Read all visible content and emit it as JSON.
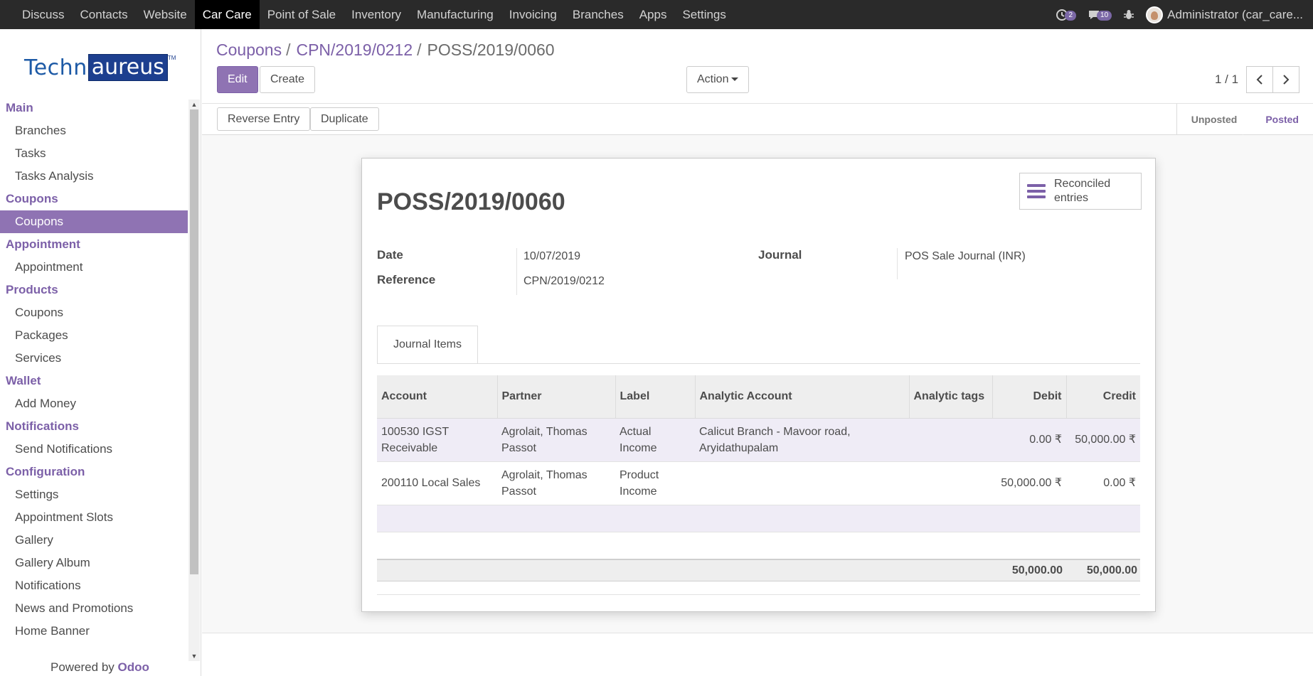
{
  "topnav": {
    "menus": [
      "Discuss",
      "Contacts",
      "Website",
      "Car Care",
      "Point of Sale",
      "Inventory",
      "Manufacturing",
      "Invoicing",
      "Branches",
      "Apps",
      "Settings"
    ],
    "active": "Car Care",
    "messages_count": "2",
    "chat_count": "10",
    "user": "Administrator (car_care..."
  },
  "sidebar": {
    "logo_left": "Techn",
    "logo_right": "aureus",
    "logo_tm": "TM",
    "sections": [
      {
        "title": "Main",
        "items": [
          "Branches",
          "Tasks",
          "Tasks Analysis"
        ]
      },
      {
        "title": "Coupons",
        "items": [
          "Coupons"
        ]
      },
      {
        "title": "Appointment",
        "items": [
          "Appointment"
        ]
      },
      {
        "title": "Products",
        "items": [
          "Coupons",
          "Packages",
          "Services"
        ]
      },
      {
        "title": "Wallet",
        "items": [
          "Add Money"
        ]
      },
      {
        "title": "Notifications",
        "items": [
          "Send Notifications"
        ]
      },
      {
        "title": "Configuration",
        "items": [
          "Settings",
          "Appointment Slots",
          "Gallery",
          "Gallery Album",
          "Notifications",
          "News and Promotions",
          "Home Banner"
        ]
      }
    ],
    "active_item": "Coupons",
    "powered_prefix": "Powered by",
    "powered_brand": "Odoo"
  },
  "breadcrumb": {
    "items": [
      "Coupons",
      "CPN/2019/0212"
    ],
    "current": "POSS/2019/0060"
  },
  "buttons": {
    "edit": "Edit",
    "create": "Create",
    "action": "Action",
    "reverse_entry": "Reverse Entry",
    "duplicate": "Duplicate"
  },
  "pager": {
    "value": "1 / 1"
  },
  "status": {
    "stages": [
      "Unposted",
      "Posted"
    ],
    "active": "Posted"
  },
  "form": {
    "smart_button": "Reconciled entries",
    "title": "POSS/2019/0060",
    "date_label": "Date",
    "date": "10/07/2019",
    "reference_label": "Reference",
    "reference": "CPN/2019/0212",
    "journal_label": "Journal",
    "journal": "POS Sale Journal (INR)",
    "tab": "Journal Items",
    "columns": [
      "Account",
      "Partner",
      "Label",
      "Analytic Account",
      "Analytic tags",
      "Debit",
      "Credit"
    ],
    "rows": [
      [
        "100530 IGST Receivable",
        "Agrolait, Thomas Passot",
        "Actual Income",
        "Calicut Branch - Mavoor road, Aryidathupalam",
        "",
        "0.00 ₹",
        "50,000.00 ₹"
      ],
      [
        "200110 Local Sales",
        "Agrolait, Thomas Passot",
        "Product Income",
        "",
        "",
        "50,000.00 ₹",
        "0.00 ₹"
      ]
    ],
    "total_debit": "50,000.00",
    "total_credit": "50,000.00"
  },
  "colors": {
    "brand": "#7c60a8",
    "active_menu_bg": "#8f73b3",
    "topbar": "#2a2a2a"
  }
}
